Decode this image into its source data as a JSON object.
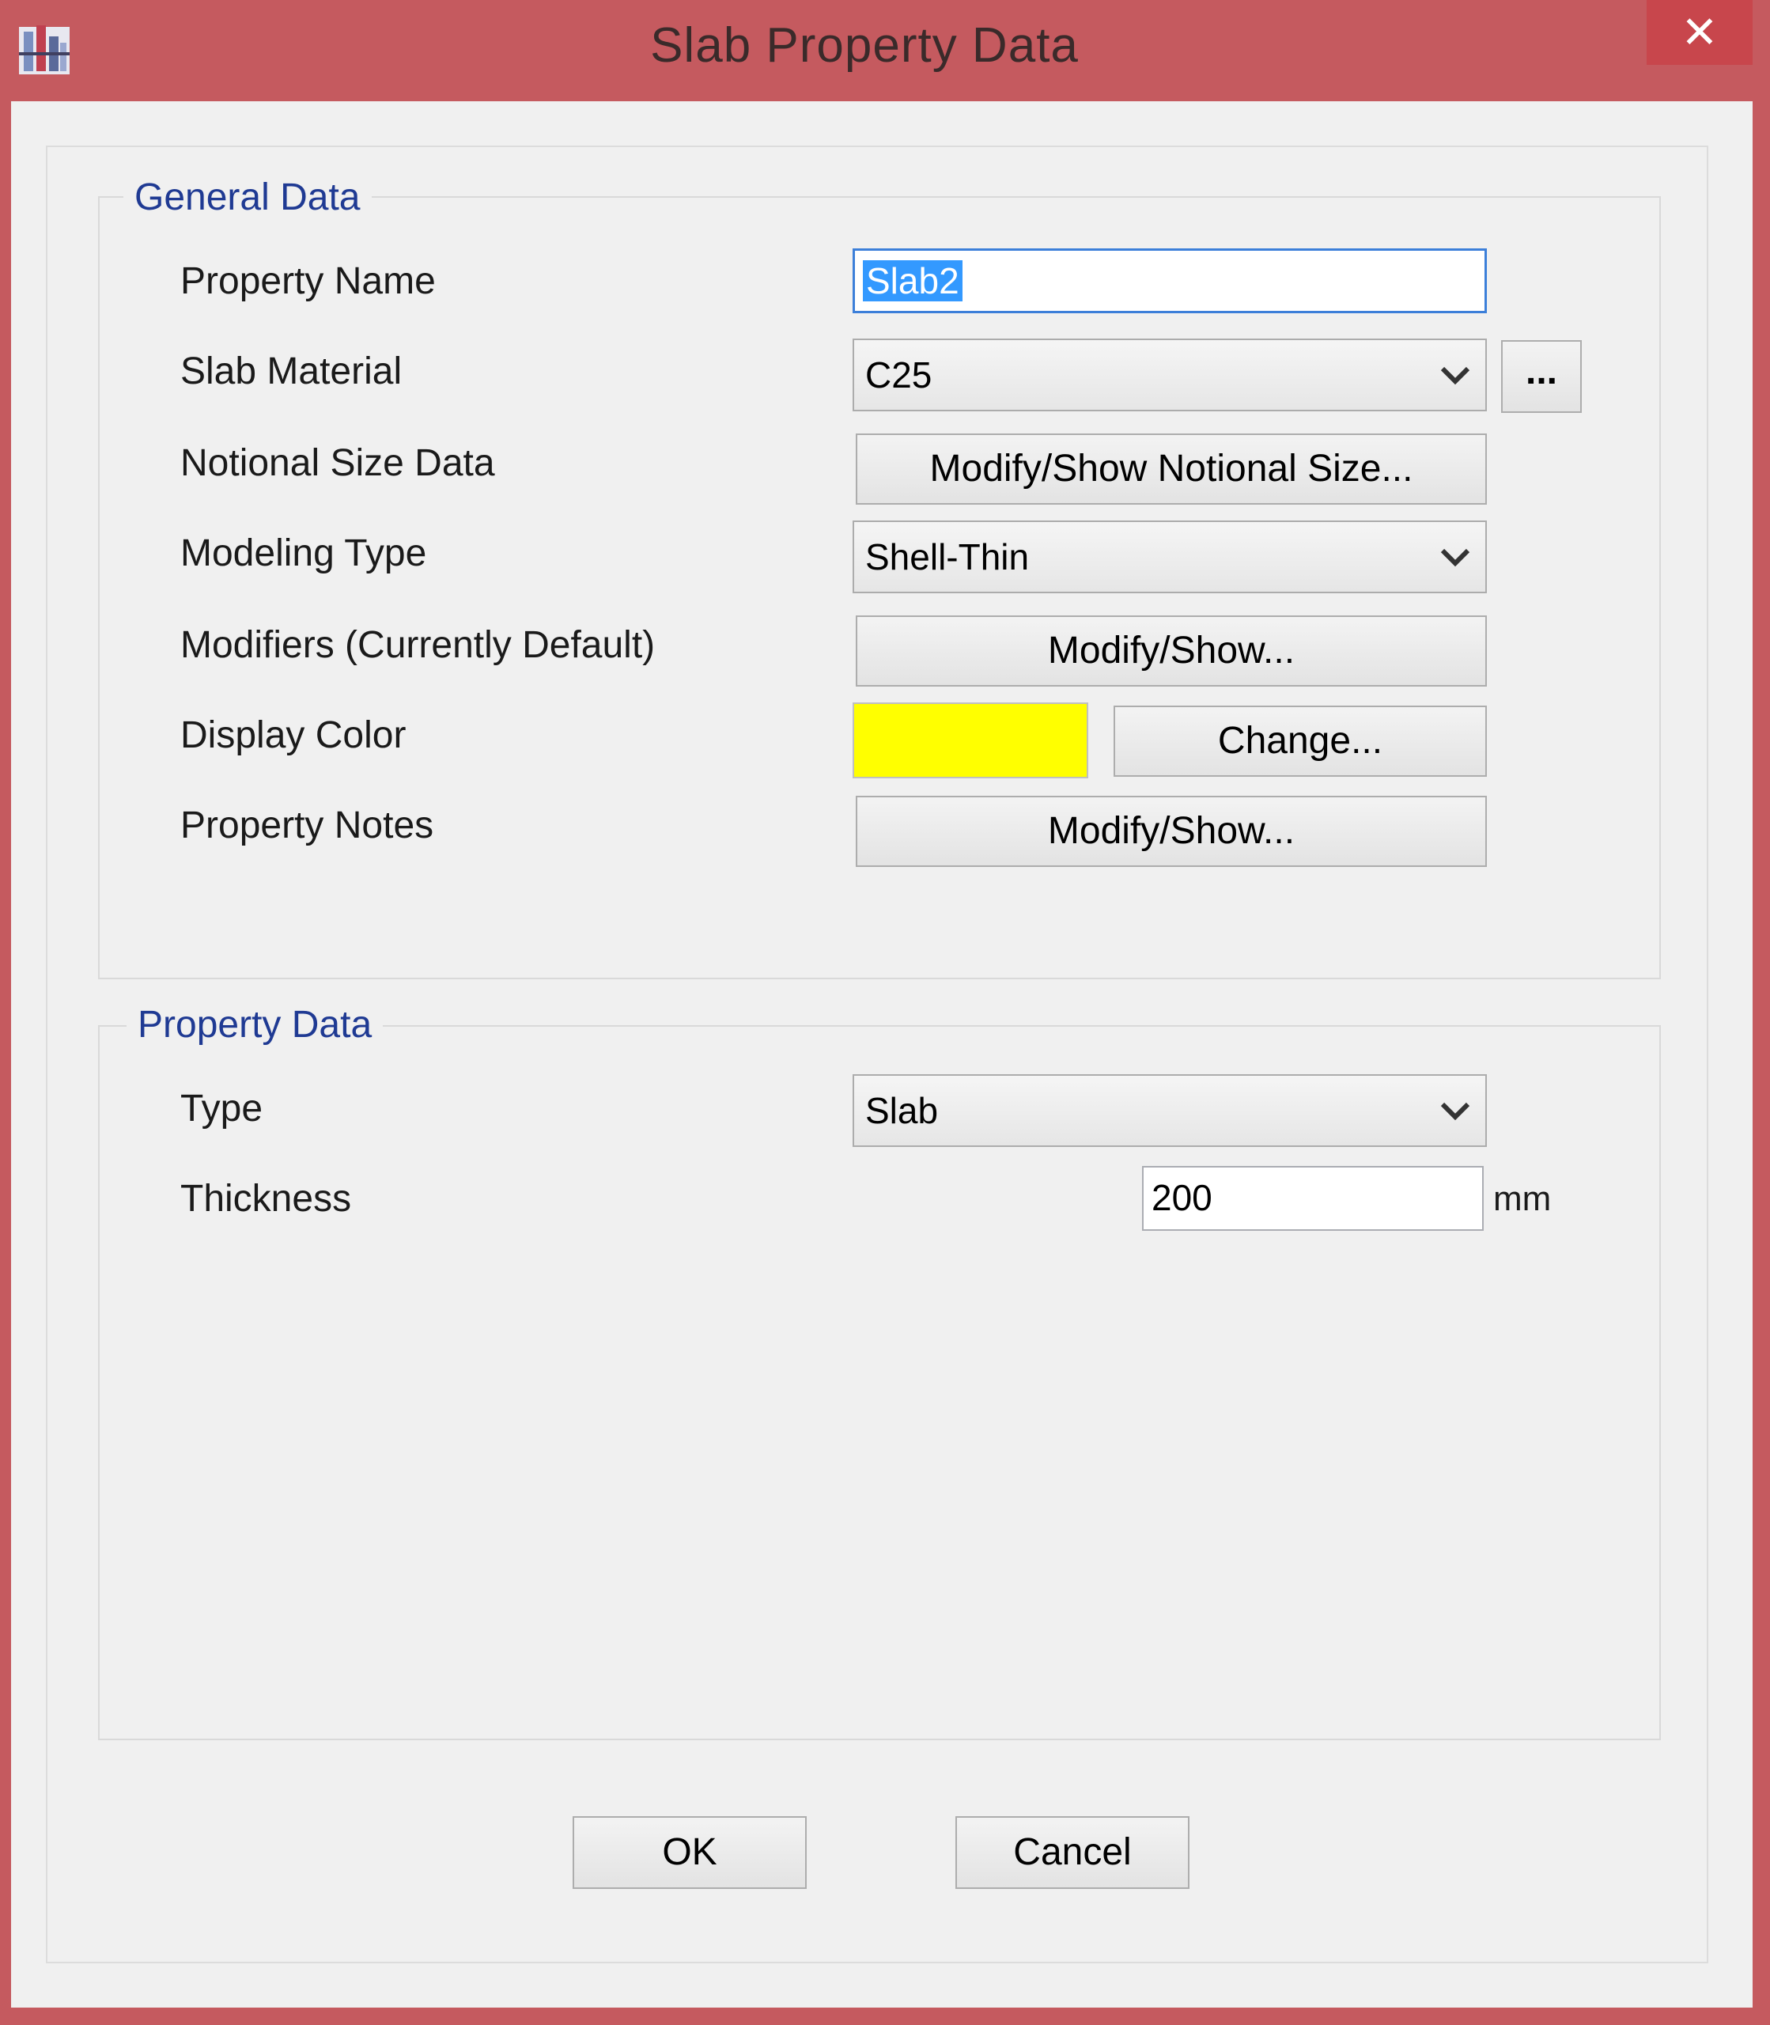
{
  "window": {
    "title": "Slab Property Data",
    "close_label": "✕"
  },
  "general": {
    "group_title": "General Data",
    "property_name_label": "Property Name",
    "property_name_value": "Slab2",
    "slab_material_label": "Slab Material",
    "slab_material_value": "C25",
    "material_browse_label": "...",
    "notional_size_label": "Notional Size Data",
    "notional_size_button": "Modify/Show Notional Size...",
    "modeling_type_label": "Modeling Type",
    "modeling_type_value": "Shell-Thin",
    "modifiers_label": "Modifiers (Currently Default)",
    "modifiers_button": "Modify/Show...",
    "display_color_label": "Display Color",
    "display_color_value": "#ffff00",
    "change_color_button": "Change...",
    "property_notes_label": "Property Notes",
    "property_notes_button": "Modify/Show..."
  },
  "property": {
    "group_title": "Property Data",
    "type_label": "Type",
    "type_value": "Slab",
    "thickness_label": "Thickness",
    "thickness_value": "200",
    "thickness_unit": "mm"
  },
  "actions": {
    "ok_label": "OK",
    "cancel_label": "Cancel"
  },
  "colors": {
    "titlebar": "#c55a5f",
    "group_title_text": "#1f3a93",
    "selection": "#3399ff"
  }
}
